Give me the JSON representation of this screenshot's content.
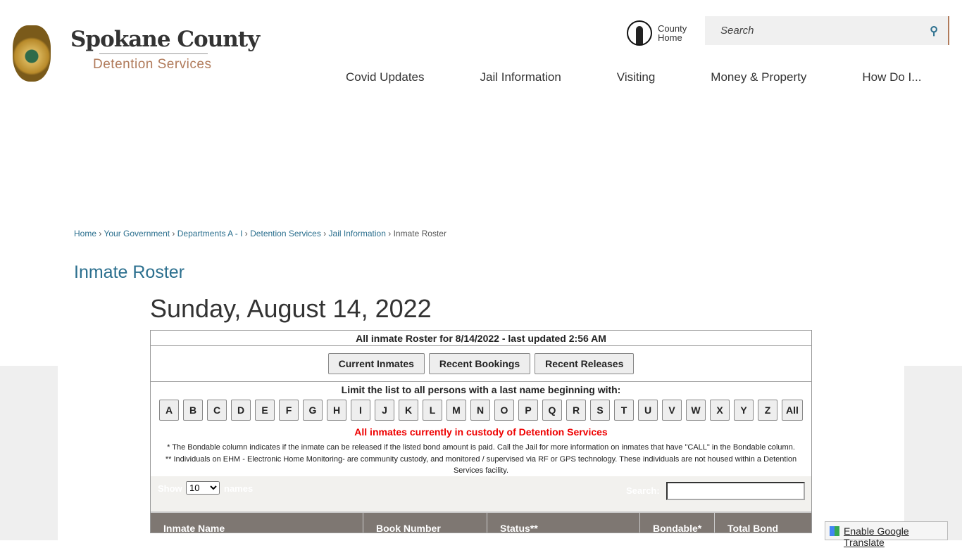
{
  "header": {
    "brand": "Spokane County",
    "subtitle": "Detention Services",
    "county_home": [
      "County",
      "Home"
    ],
    "search_placeholder": "Search"
  },
  "nav": [
    "Covid Updates",
    "Jail Information",
    "Visiting",
    "Money & Property",
    "How Do I..."
  ],
  "breadcrumb": [
    "Home",
    "Your Government",
    "Departments A - I",
    "Detention Services",
    "Jail Information"
  ],
  "breadcrumb_current": "Inmate Roster",
  "page_title": "Inmate Roster",
  "date": "Sunday, August 14, 2022",
  "roster": {
    "caption": "All inmate Roster for 8/14/2022 - last updated 2:56 AM",
    "buttons": [
      "Current Inmates",
      "Recent Bookings",
      "Recent Releases"
    ],
    "limit_label": "Limit the list to all persons with a last name beginning with:",
    "letters": [
      "A",
      "B",
      "C",
      "D",
      "E",
      "F",
      "G",
      "H",
      "I",
      "J",
      "K",
      "L",
      "M",
      "N",
      "O",
      "P",
      "Q",
      "R",
      "S",
      "T",
      "U",
      "V",
      "W",
      "X",
      "Y",
      "Z",
      "All"
    ],
    "status": "All inmates currently in custody of Detention Services",
    "note1": "* The Bondable column indicates if the inmate can be released if the listed bond amount is paid. Call the Jail for more information on inmates that have \"CALL\" in the Bondable column.",
    "note2": "** Individuals on EHM - Electronic Home Monitoring- are community custody, and monitored / supervised via RF or GPS technology. These individuals are not housed within a Detention Services facility.",
    "show_label": "Show",
    "show_value": "10",
    "names_label": "names",
    "search_label": "Search:",
    "columns": [
      "Inmate Name",
      "Book Number",
      "Status**",
      "Bondable*",
      "Total Bond"
    ]
  },
  "translate": "Enable Google Translate"
}
